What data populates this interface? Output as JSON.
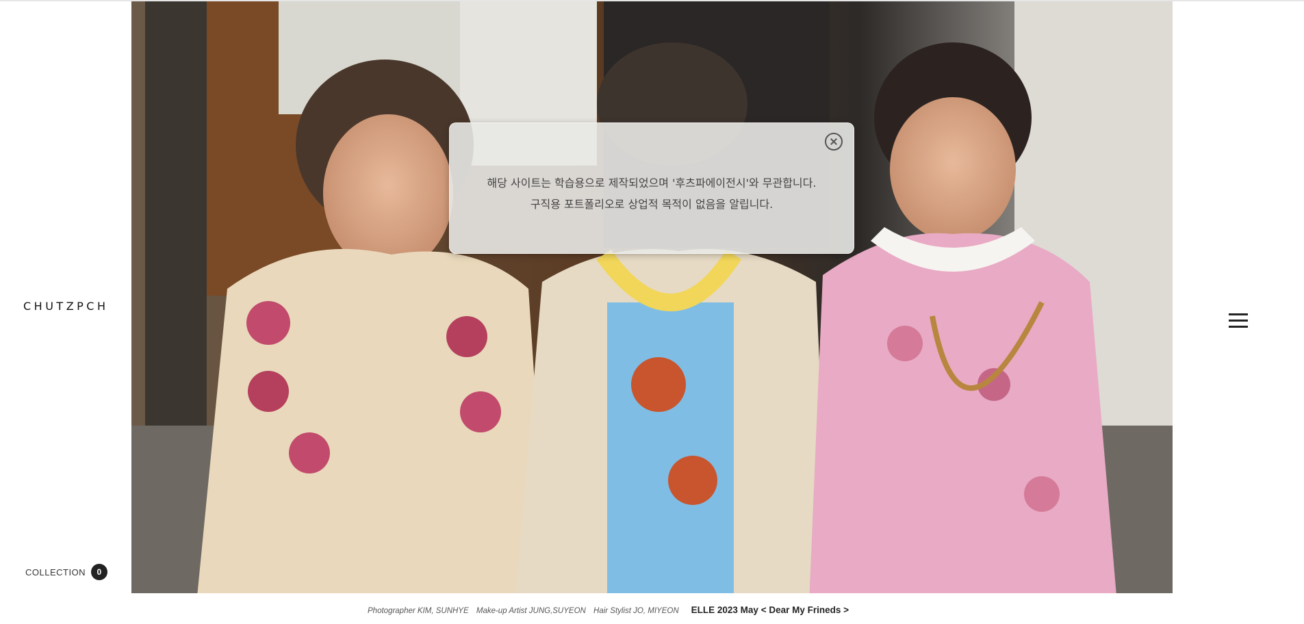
{
  "brand": {
    "logo": "CHUTZPCH"
  },
  "collection": {
    "label": "COLLECTION",
    "count": "0"
  },
  "popup": {
    "line1": "해당 사이트는 학습용으로 제작되었으며 '후츠파에이전시'와 무관합니다.",
    "line2": "구직용 포트폴리오로 상업적 목적이 없음을 알립니다."
  },
  "caption": {
    "photographer": "Photographer KIM, SUNHYE",
    "makeup": "Make-up Artist JUNG,SUYEON",
    "hair": "Hair Stylist JO, MIYEON",
    "title": "ELLE 2023 May < Dear My Frineds >"
  },
  "icons": {
    "menu": "hamburger-menu-icon",
    "close": "close-circle-icon"
  },
  "colors": {
    "accent": "#222222",
    "popup_bg": "#e8e8e6"
  }
}
